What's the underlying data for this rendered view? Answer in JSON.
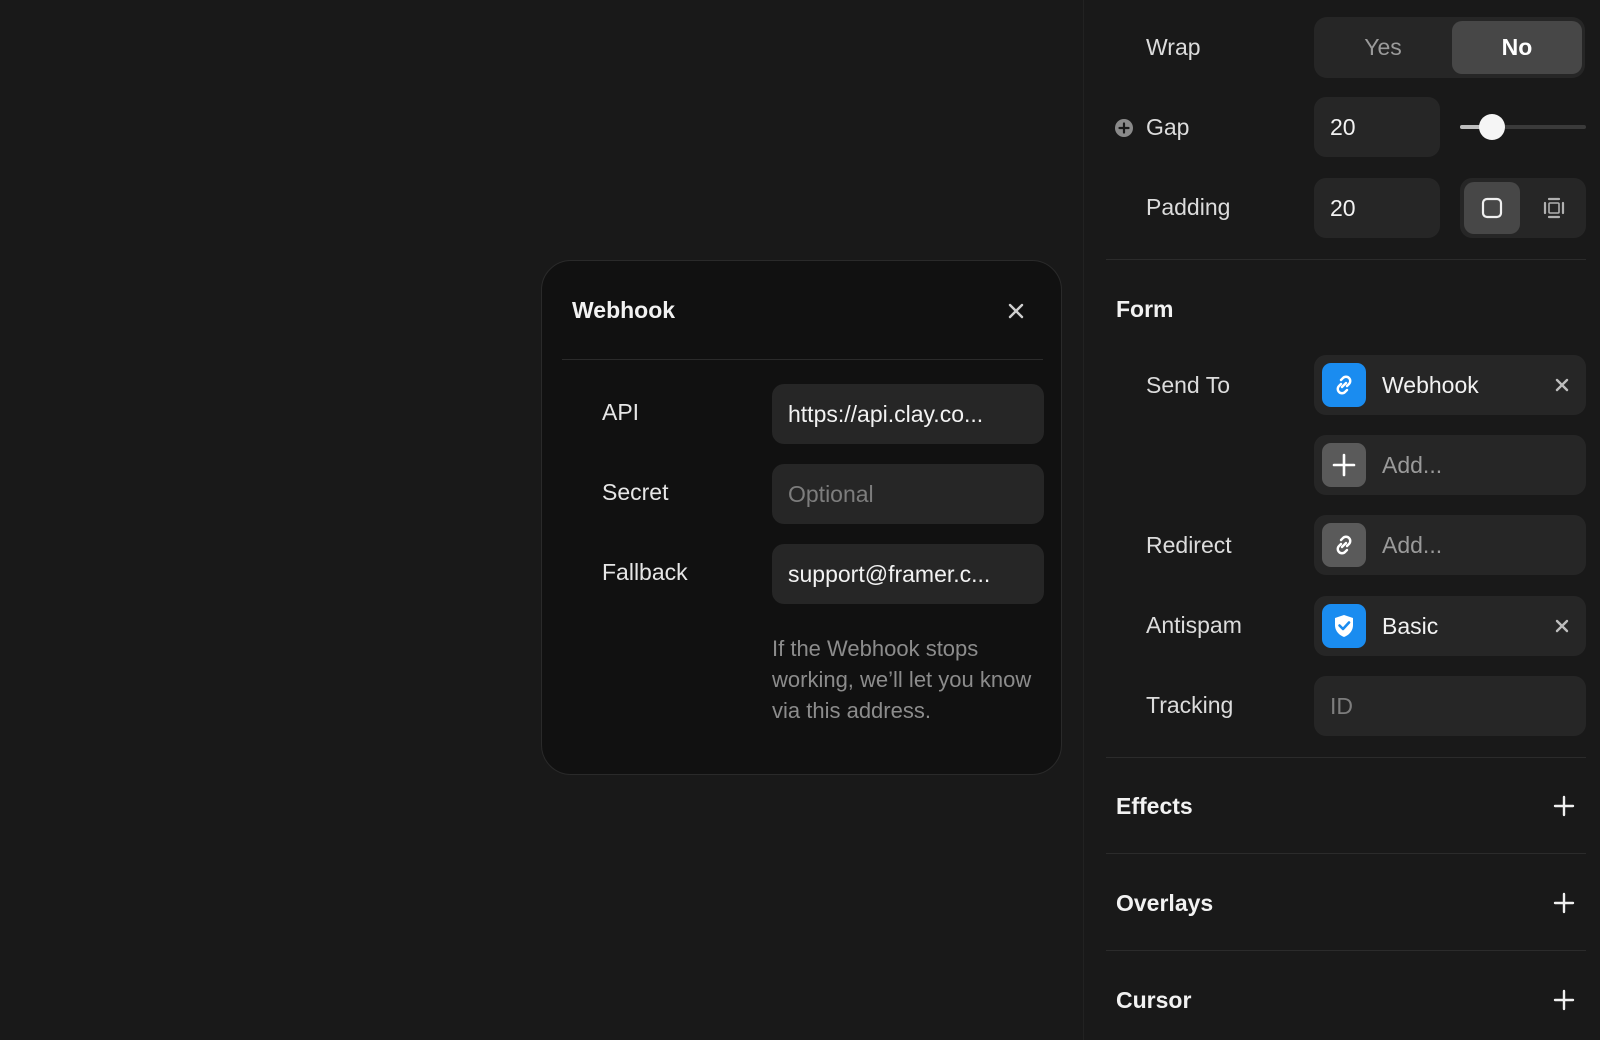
{
  "modal": {
    "title": "Webhook",
    "fields": [
      {
        "label": "API",
        "value": "https://api.clay.co...",
        "placeholder": ""
      },
      {
        "label": "Secret",
        "value": "",
        "placeholder": "Optional"
      },
      {
        "label": "Fallback",
        "value": "support@framer.c...",
        "placeholder": ""
      }
    ],
    "help": "If the Webhook stops working, we’ll let you know via this address."
  },
  "layout_props": {
    "wrap": {
      "label": "Wrap",
      "options": [
        "Yes",
        "No"
      ],
      "selected": "No"
    },
    "gap": {
      "label": "Gap",
      "value": "20",
      "slider_fraction": 0.25
    },
    "padding": {
      "label": "Padding",
      "value": "20",
      "mode": "uniform"
    }
  },
  "form": {
    "title": "Form",
    "send_to": {
      "label": "Send To",
      "value": "Webhook",
      "add_placeholder": "Add..."
    },
    "redirect": {
      "label": "Redirect",
      "placeholder": "Add..."
    },
    "antispam": {
      "label": "Antispam",
      "value": "Basic"
    },
    "tracking": {
      "label": "Tracking",
      "placeholder": "ID"
    }
  },
  "sections": [
    {
      "title": "Effects"
    },
    {
      "title": "Overlays"
    },
    {
      "title": "Cursor"
    }
  ],
  "colors": {
    "accent": "#1a8cf0",
    "background": "#191919",
    "modal": "#111111",
    "field": "#262626"
  },
  "icons": [
    "close-icon",
    "link-icon",
    "plus-icon",
    "shield-check-icon",
    "padding-uniform-icon",
    "padding-individual-icon",
    "plus-circle-icon"
  ]
}
